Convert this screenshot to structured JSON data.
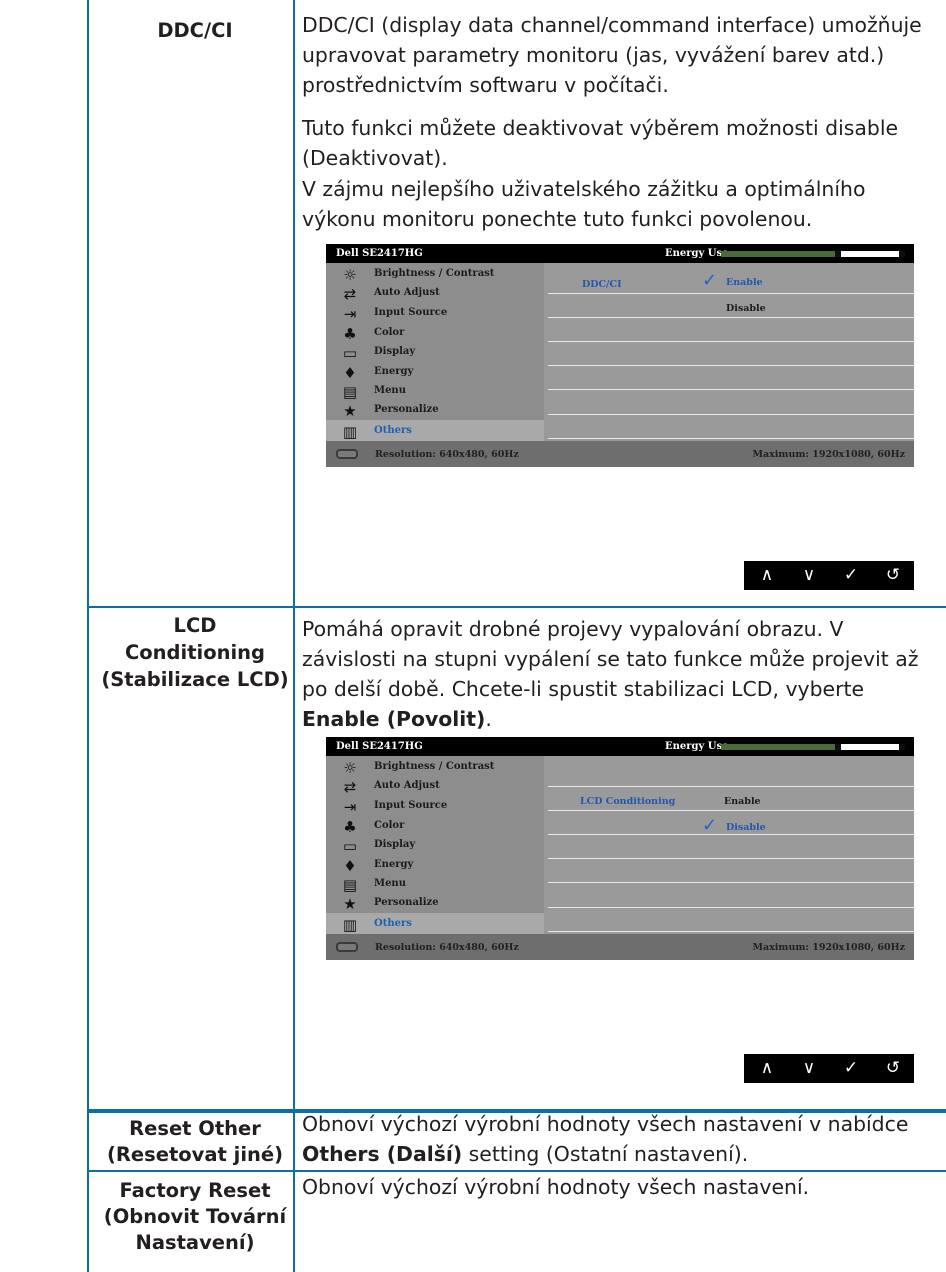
{
  "rows": {
    "ddc": {
      "label": "DDC/CI",
      "desc1": "DDC/CI (display data channel/command interface) umožňuje upravovat parametry monitoru (jas, vyvážení barev atd.) prostřednictvím softwaru v počítači.",
      "desc2": "Tuto funkci můžete deaktivovat výběrem možnosti disable (Deaktivovat).",
      "desc3": "V zájmu nejlepšího uživatelského zážitku a optimálního výkonu monitoru ponechte tuto funkci povolenou."
    },
    "lcd": {
      "label_line1": "LCD",
      "label_line2": "Conditioning",
      "label_line3": "(Stabilizace LCD)",
      "desc_main": "Pomáhá opravit drobné projevy vypalování obrazu. V závislosti na stupni vypálení se tato funkce může projevit až po delší době. Chcete-li spustit stabilizaci LCD, vyberte ",
      "desc_bold": "Enable (Povolit)",
      "desc_end": "."
    },
    "reset_other": {
      "label_line1": "Reset Other",
      "label_line2": "(Resetovat jiné)",
      "desc_pre": "Obnoví výchozí výrobní hodnoty všech nastavení v nabídce ",
      "desc_bold": "Others (Další)",
      "desc_post": " setting (Ostatní nastavení)."
    },
    "factory_reset": {
      "label_line1": "Factory Reset",
      "label_line2": "(Obnovit Tovární",
      "label_line3": "Nastavení)",
      "desc": "Obnoví výchozí výrobní hodnoty všech nastavení."
    }
  },
  "osd": {
    "model": "Dell SE2417HG",
    "energy_label": "Energy Use",
    "energy_level": 0.62,
    "menu_items": [
      {
        "label": "Brightness / Contrast",
        "icon": "brightness-icon",
        "glyph": "☼"
      },
      {
        "label": "Auto Adjust",
        "icon": "auto-adjust-icon",
        "glyph": "⇄"
      },
      {
        "label": "Input Source",
        "icon": "input-source-icon",
        "glyph": "⇥"
      },
      {
        "label": "Color",
        "icon": "color-icon",
        "glyph": "♣"
      },
      {
        "label": "Display",
        "icon": "display-icon",
        "glyph": "▭"
      },
      {
        "label": "Energy",
        "icon": "energy-icon",
        "glyph": "♦"
      },
      {
        "label": "Menu",
        "icon": "menu-icon",
        "glyph": "▤"
      },
      {
        "label": "Personalize",
        "icon": "personalize-icon",
        "glyph": "★"
      },
      {
        "label": "Others",
        "icon": "others-icon",
        "glyph": "▥"
      }
    ],
    "selected_item": "Others",
    "resolution": "Resolution: 640x480, 60Hz",
    "maximum": "Maximum: 1920x1080, 60Hz",
    "ddc_panel": {
      "option": "DDC/CI",
      "enable": "Enable",
      "disable": "Disable",
      "checked": "Enable"
    },
    "lcd_panel": {
      "option": "LCD Conditioning",
      "enable": "Enable",
      "disable": "Disable",
      "checked": "Disable"
    },
    "nav_buttons": [
      {
        "name": "up-button",
        "glyph": "∧"
      },
      {
        "name": "down-button",
        "glyph": "∨"
      },
      {
        "name": "ok-button",
        "glyph": "✓"
      },
      {
        "name": "back-button",
        "glyph": "↺"
      }
    ]
  },
  "colors": {
    "rule": "#0b6fa4",
    "osd_bg": "#9a9a9a",
    "selection_text": "#1f5fb4",
    "energy_green": "#4a6b37"
  }
}
